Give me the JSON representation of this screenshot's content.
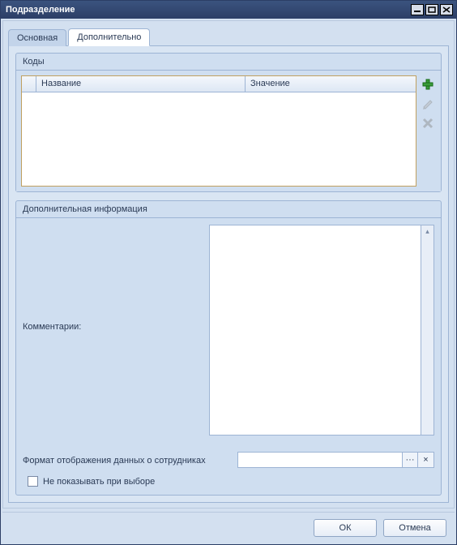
{
  "window": {
    "title": "Подразделение"
  },
  "tabs": {
    "main": "Основная",
    "extra": "Дополнительно"
  },
  "codes": {
    "group_title": "Коды",
    "col_name": "Название",
    "col_value": "Значение",
    "rows": []
  },
  "info": {
    "group_title": "Дополнительная информация",
    "comments_label": "Комментарии:",
    "comments_value": "",
    "format_label": "Формат отображения данных о сотрудниках",
    "format_value": "",
    "hide_checkbox_label": "Не показывать при выборе",
    "hide_checkbox_checked": false
  },
  "buttons": {
    "ok": "ОК",
    "cancel": "Отмена"
  },
  "icons": {
    "add": "plus-icon",
    "edit": "pencil-icon",
    "delete": "x-icon",
    "picker_open": "ellipsis-icon",
    "picker_clear": "clear-icon"
  }
}
